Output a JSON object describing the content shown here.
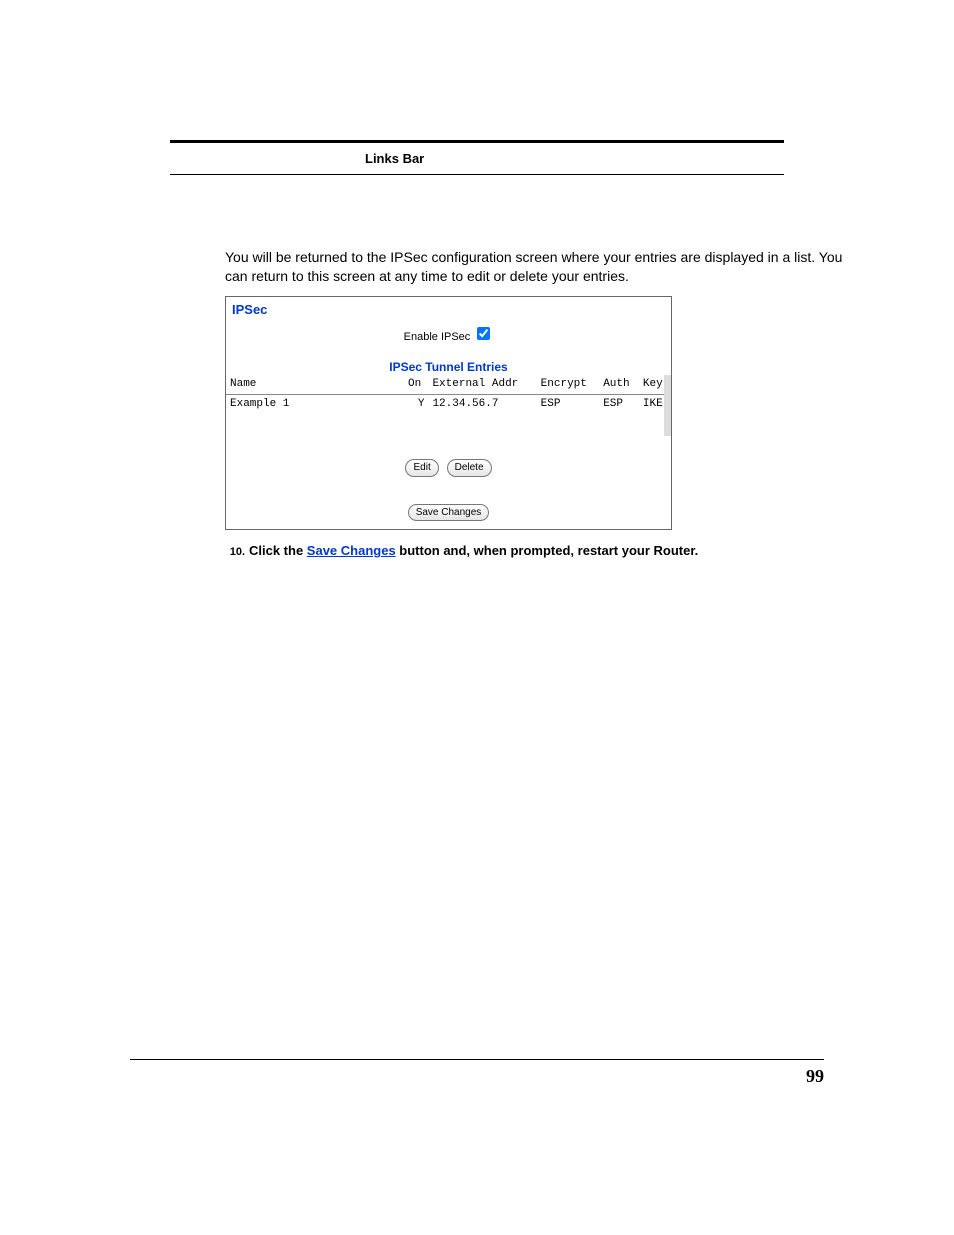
{
  "header": {
    "links_bar": "Links Bar"
  },
  "intro": {
    "text": "You will be returned to the IPSec configuration screen where your entries are displayed in a list. You can return to this screen at any time to edit or delete your entries."
  },
  "figure": {
    "title": "IPSec",
    "enable_label": "Enable IPSec",
    "enable_checked": true,
    "subtitle": "IPSec Tunnel Entries",
    "columns": {
      "name": "Name",
      "on": "On",
      "ext_addr": "External Addr",
      "encrypt": "Encrypt",
      "auth": "Auth",
      "key": "Key"
    },
    "rows": [
      {
        "name": "Example 1",
        "on": "Y",
        "ext_addr": "12.34.56.7",
        "encrypt": "ESP",
        "auth": "ESP",
        "key": "IKE"
      }
    ],
    "buttons": {
      "edit": "Edit",
      "delete": "Delete",
      "save": "Save Changes"
    }
  },
  "step": {
    "number": "10.",
    "prefix": "Click the ",
    "link": "Save Changes",
    "suffix": " button and, when prompted, restart your Router."
  },
  "footer": {
    "page_number": "99"
  }
}
